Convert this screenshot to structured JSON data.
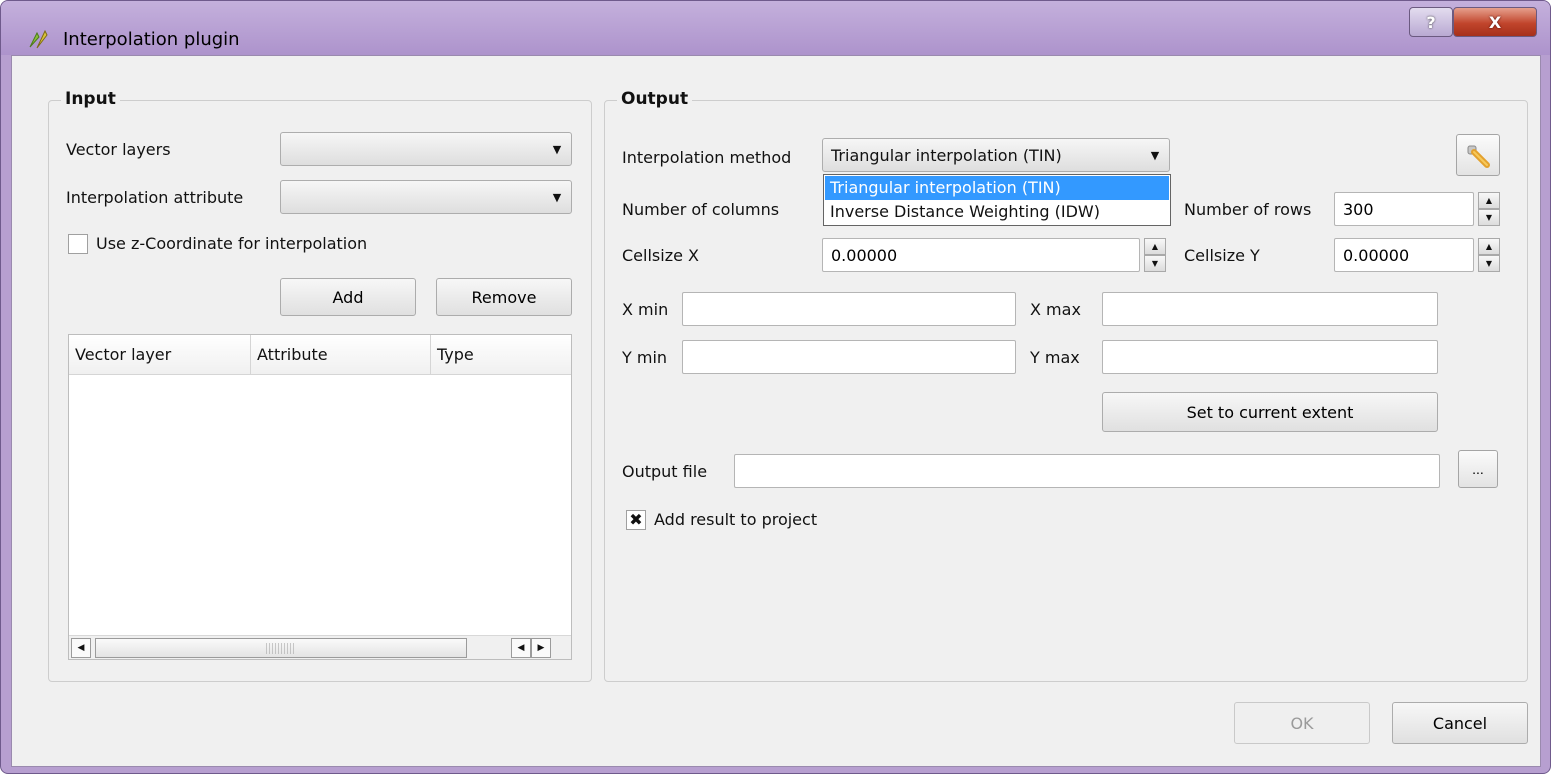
{
  "window": {
    "title": "Interpolation plugin",
    "help_label": "?",
    "close_label": "X"
  },
  "input": {
    "group_title": "Input",
    "vector_layers_label": "Vector layers",
    "vector_layers_value": "",
    "interp_attr_label": "Interpolation attribute",
    "interp_attr_value": "",
    "use_z_label": "Use z-Coordinate for interpolation",
    "use_z_checked": false,
    "add_label": "Add",
    "remove_label": "Remove",
    "table_columns": [
      "Vector layer",
      "Attribute",
      "Type"
    ]
  },
  "output": {
    "group_title": "Output",
    "interp_method_label": "Interpolation method",
    "interp_method_value": "Triangular interpolation (TIN)",
    "method_options": [
      "Triangular interpolation (TIN)",
      "Inverse Distance Weighting (IDW)"
    ],
    "columns_label": "Number of columns",
    "rows_label": "Number of rows",
    "rows_value": "300",
    "cellsize_x_label": "Cellsize X",
    "cellsize_x_value": "0.00000",
    "cellsize_y_label": "Cellsize Y",
    "cellsize_y_value": "0.00000",
    "xmin_label": "X min",
    "xmax_label": "X max",
    "ymin_label": "Y min",
    "ymax_label": "Y max",
    "set_extent_label": "Set to current extent",
    "output_file_label": "Output file",
    "output_file_value": "",
    "browse_label": "...",
    "add_result_label": "Add result to project",
    "add_result_checked": true,
    "add_result_mark": "✖"
  },
  "footer": {
    "ok_label": "OK",
    "cancel_label": "Cancel"
  },
  "icons": {
    "app": "qgis-plugin-icon",
    "settings": "wrench-icon"
  }
}
